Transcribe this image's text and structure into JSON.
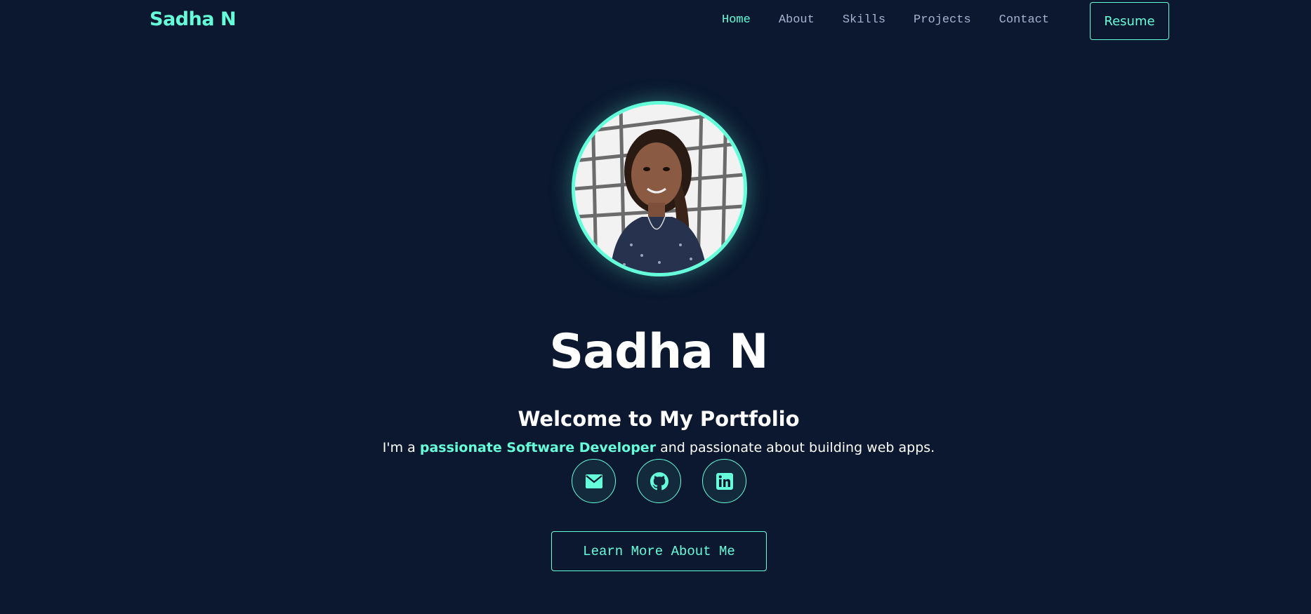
{
  "nav": {
    "brand": "Sadha N",
    "links": [
      {
        "label": "Home",
        "active": true
      },
      {
        "label": "About",
        "active": false
      },
      {
        "label": "Skills",
        "active": false
      },
      {
        "label": "Projects",
        "active": false
      },
      {
        "label": "Contact",
        "active": false
      }
    ],
    "resume_label": "Resume"
  },
  "hero": {
    "avatar_alt": "profile-photo",
    "name": "Sadha N",
    "welcome": "Welcome to My Portfolio",
    "tagline_prefix": "I'm a ",
    "tagline_highlight": "passionate Software Developer",
    "tagline_suffix": " and passionate about building web apps.",
    "socials": [
      {
        "icon": "envelope-icon",
        "name": "email-link"
      },
      {
        "icon": "github-icon",
        "name": "github-link"
      },
      {
        "icon": "linkedin-icon",
        "name": "linkedin-link"
      }
    ],
    "cta_label": "Learn More About Me"
  },
  "colors": {
    "background": "#0b182f",
    "accent": "#64ffda",
    "nav_text": "#a8b2d1",
    "heading": "#ffffff"
  }
}
